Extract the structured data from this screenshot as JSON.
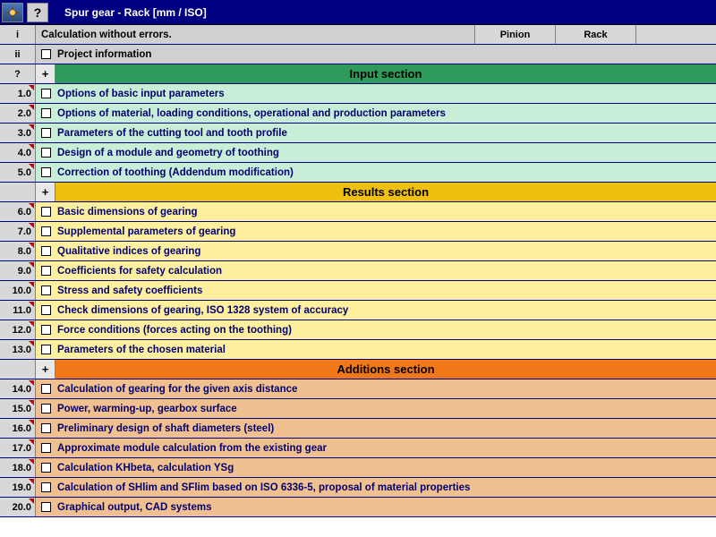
{
  "titlebar": {
    "title": "Spur gear - Rack [mm / ISO]"
  },
  "header": {
    "row_i_label": "i",
    "row_i_text": "Calculation without errors.",
    "col_pinion": "Pinion",
    "col_rack": "Rack",
    "row_ii_label": "ii",
    "row_ii_text": "Project information"
  },
  "sections": {
    "input": {
      "qmark": "?",
      "plus": "+",
      "title": "Input section",
      "rows": [
        {
          "num": "1.0",
          "text": "Options of basic input parameters"
        },
        {
          "num": "2.0",
          "text": "Options of material, loading conditions, operational and production parameters"
        },
        {
          "num": "3.0",
          "text": "Parameters of the cutting tool and tooth profile"
        },
        {
          "num": "4.0",
          "text": "Design of a module and geometry of toothing"
        },
        {
          "num": "5.0",
          "text": "Correction of toothing (Addendum modification)"
        }
      ]
    },
    "results": {
      "plus": "+",
      "title": "Results section",
      "rows": [
        {
          "num": "6.0",
          "text": "Basic dimensions of gearing"
        },
        {
          "num": "7.0",
          "text": "Supplemental parameters of gearing"
        },
        {
          "num": "8.0",
          "text": "Qualitative indices of gearing"
        },
        {
          "num": "9.0",
          "text": "Coefficients for safety calculation"
        },
        {
          "num": "10.0",
          "text": "Stress and safety coefficients"
        },
        {
          "num": "11.0",
          "text": "Check dimensions of gearing, ISO 1328 system of accuracy"
        },
        {
          "num": "12.0",
          "text": "Force conditions (forces acting on the toothing)"
        },
        {
          "num": "13.0",
          "text": "Parameters of the chosen material"
        }
      ]
    },
    "additions": {
      "plus": "+",
      "title": "Additions section",
      "rows": [
        {
          "num": "14.0",
          "text": "Calculation of gearing for the given axis distance"
        },
        {
          "num": "15.0",
          "text": "Power, warming-up, gearbox surface"
        },
        {
          "num": "16.0",
          "text": "Preliminary design of shaft diameters (steel)"
        },
        {
          "num": "17.0",
          "text": "Approximate module calculation from the existing gear"
        },
        {
          "num": "18.0",
          "text": "Calculation KHbeta, calculation YSg"
        },
        {
          "num": "19.0",
          "text": "Calculation of SHlim and SFlim based on ISO 6336-5, proposal of material properties"
        },
        {
          "num": "20.0",
          "text": "Graphical output, CAD systems"
        }
      ]
    }
  }
}
